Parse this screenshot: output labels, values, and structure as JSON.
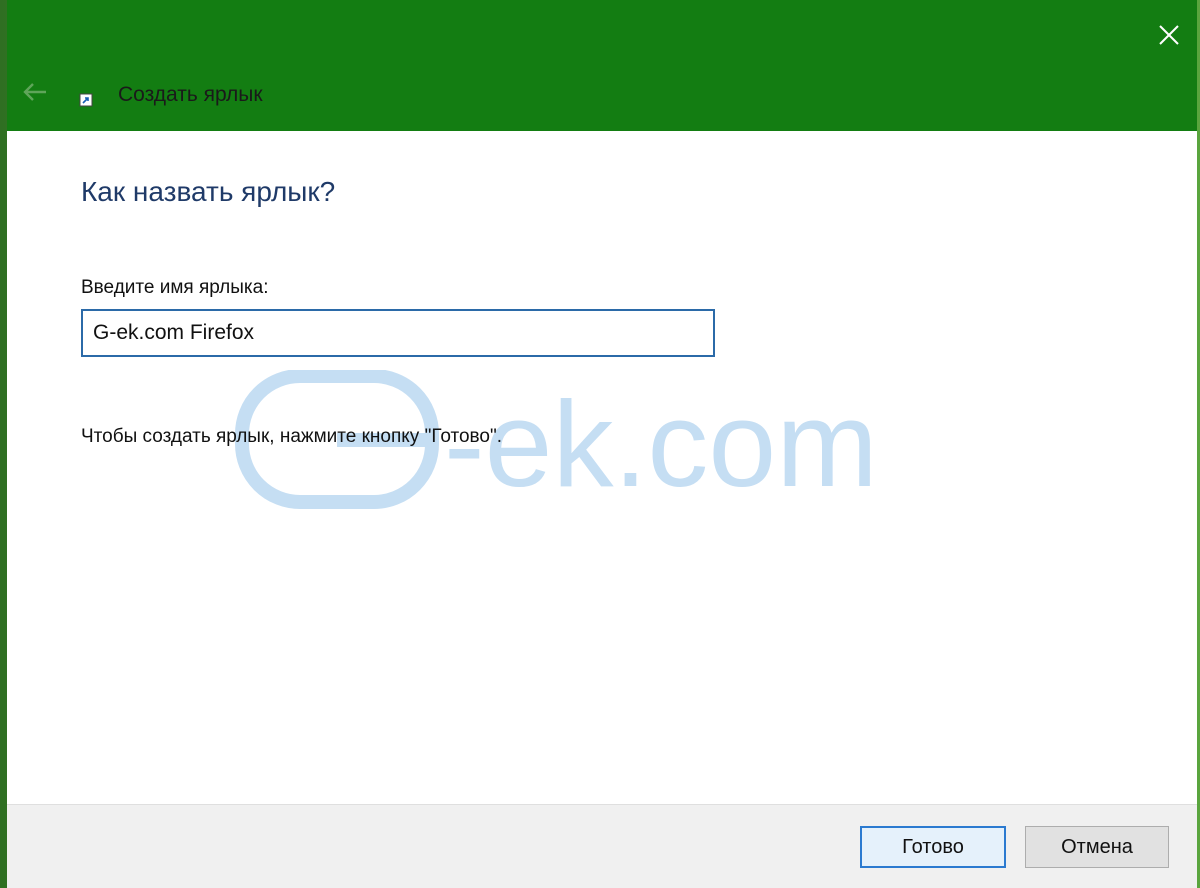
{
  "window": {
    "title": "Создать ярлык",
    "accent_color": "#137d12"
  },
  "icons": {
    "back": "arrow-left-icon",
    "close": "close-icon",
    "shortcut": "shortcut-icon"
  },
  "main": {
    "heading": "Как назвать ярлык?",
    "name_label": "Введите имя ярлыка:",
    "name_value": "G-ek.com Firefox",
    "hint": "Чтобы создать ярлык, нажмите кнопку \"Готово\"."
  },
  "watermark": {
    "text": "G-ek.com",
    "color": "#c5def3"
  },
  "footer": {
    "done_label": "Готово",
    "cancel_label": "Отмена"
  }
}
